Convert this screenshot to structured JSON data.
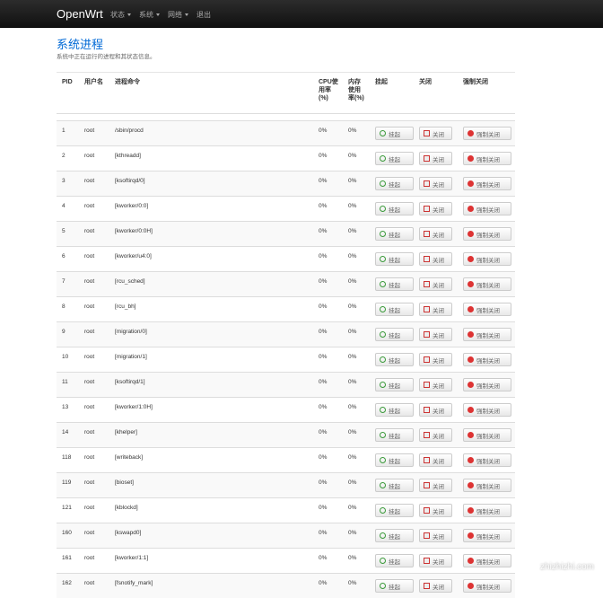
{
  "nav": {
    "brand": "OpenWrt",
    "items": [
      {
        "label": "状态"
      },
      {
        "label": "系统"
      },
      {
        "label": "网络"
      },
      {
        "label": "退出"
      }
    ]
  },
  "page": {
    "title": "系统进程",
    "description": "系统中正在运行的进程和其状态信息。"
  },
  "table": {
    "headers": {
      "pid": "PID",
      "user": "用户名",
      "command": "进程命令",
      "cpu": "CPU使用率(%)",
      "mem": "内存使用率(%)",
      "hang": "挂起",
      "close": "关闭",
      "kill": "强制关闭"
    },
    "rows": [
      {
        "pid": "1",
        "user": "root",
        "command": "/sbin/procd",
        "cpu": "0%",
        "mem": "0%"
      },
      {
        "pid": "2",
        "user": "root",
        "command": "[kthreadd]",
        "cpu": "0%",
        "mem": "0%"
      },
      {
        "pid": "3",
        "user": "root",
        "command": "[ksoftirqd/0]",
        "cpu": "0%",
        "mem": "0%"
      },
      {
        "pid": "4",
        "user": "root",
        "command": "[kworker/0:0]",
        "cpu": "0%",
        "mem": "0%"
      },
      {
        "pid": "5",
        "user": "root",
        "command": "[kworker/0:0H]",
        "cpu": "0%",
        "mem": "0%"
      },
      {
        "pid": "6",
        "user": "root",
        "command": "[kworker/u4:0]",
        "cpu": "0%",
        "mem": "0%"
      },
      {
        "pid": "7",
        "user": "root",
        "command": "[rcu_sched]",
        "cpu": "0%",
        "mem": "0%"
      },
      {
        "pid": "8",
        "user": "root",
        "command": "[rcu_bh]",
        "cpu": "0%",
        "mem": "0%"
      },
      {
        "pid": "9",
        "user": "root",
        "command": "[migration/0]",
        "cpu": "0%",
        "mem": "0%"
      },
      {
        "pid": "10",
        "user": "root",
        "command": "[migration/1]",
        "cpu": "0%",
        "mem": "0%"
      },
      {
        "pid": "11",
        "user": "root",
        "command": "[ksoftirqd/1]",
        "cpu": "0%",
        "mem": "0%"
      },
      {
        "pid": "13",
        "user": "root",
        "command": "[kworker/1:0H]",
        "cpu": "0%",
        "mem": "0%"
      },
      {
        "pid": "14",
        "user": "root",
        "command": "[khelper]",
        "cpu": "0%",
        "mem": "0%"
      },
      {
        "pid": "118",
        "user": "root",
        "command": "[writeback]",
        "cpu": "0%",
        "mem": "0%"
      },
      {
        "pid": "119",
        "user": "root",
        "command": "[bioset]",
        "cpu": "0%",
        "mem": "0%"
      },
      {
        "pid": "121",
        "user": "root",
        "command": "[kblockd]",
        "cpu": "0%",
        "mem": "0%"
      },
      {
        "pid": "160",
        "user": "root",
        "command": "[kswapd0]",
        "cpu": "0%",
        "mem": "0%"
      },
      {
        "pid": "161",
        "user": "root",
        "command": "[kworker/1:1]",
        "cpu": "0%",
        "mem": "0%"
      },
      {
        "pid": "162",
        "user": "root",
        "command": "[fsnotify_mark]",
        "cpu": "0%",
        "mem": "0%"
      }
    ],
    "buttons": {
      "hang": "挂起",
      "close": "关闭",
      "kill": "强制关闭"
    }
  },
  "watermark": "zhizhizhi.com",
  "icons": {
    "hang": "refresh-icon",
    "close": "close-icon",
    "kill": "stop-icon"
  }
}
